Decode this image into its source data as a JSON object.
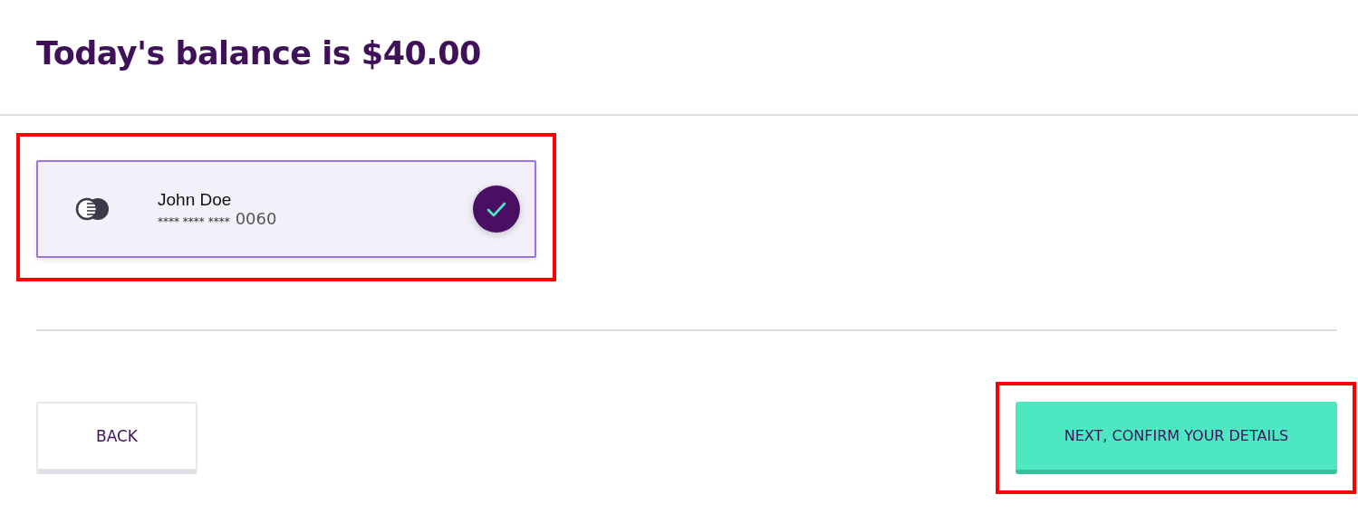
{
  "heading": "Today's balance is $40.00",
  "payment_card": {
    "name": "John Doe",
    "masked_number": "**** **** ****",
    "last_digits": "0060",
    "selected": true,
    "highlighted": true
  },
  "buttons": [
    {
      "kind": "secondary",
      "label": "BACK",
      "highlighted": false
    },
    {
      "kind": "primary",
      "label": "NEXT, CONFIRM YOUR DETAILS",
      "highlighted": true
    }
  ]
}
